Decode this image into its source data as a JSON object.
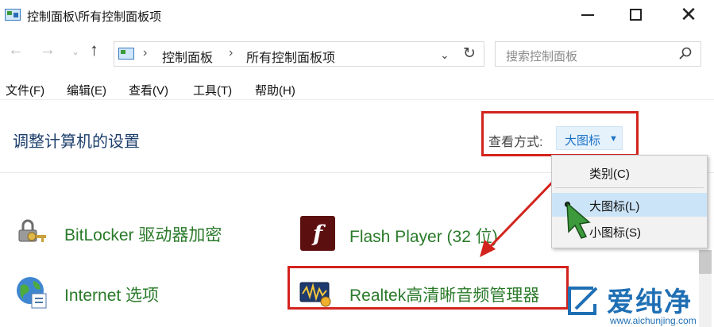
{
  "window": {
    "title": "控制面板\\所有控制面板项"
  },
  "nav": {
    "breadcrumb": [
      "控制面板",
      "所有控制面板项"
    ],
    "search_placeholder": "搜索控制面板"
  },
  "menu": {
    "items": [
      "文件(F)",
      "编辑(E)",
      "查看(V)",
      "工具(T)",
      "帮助(H)"
    ]
  },
  "header": {
    "title": "调整计算机的设置",
    "view_label": "查看方式:",
    "view_value": "大图标"
  },
  "view_menu": {
    "options": [
      "类别(C)",
      "大图标(L)",
      "小图标(S)"
    ],
    "selected": "大图标(L)"
  },
  "items": [
    {
      "label": "BitLocker 驱动器加密",
      "icon": "bitlocker-icon"
    },
    {
      "label": "Flash Player (32 位)",
      "icon": "flash-icon"
    },
    {
      "label": "Internet 选项",
      "icon": "internet-options-icon"
    },
    {
      "label": "Realtek高清晰音频管理器",
      "icon": "realtek-audio-icon"
    }
  ],
  "flash_glyph": "f",
  "watermark": {
    "text": "爱纯净",
    "url": "www.aichunjing.com"
  },
  "colors": {
    "highlight_red": "#d3231d",
    "link_green": "#2a7a2a",
    "accent_blue": "#1b73c7"
  }
}
